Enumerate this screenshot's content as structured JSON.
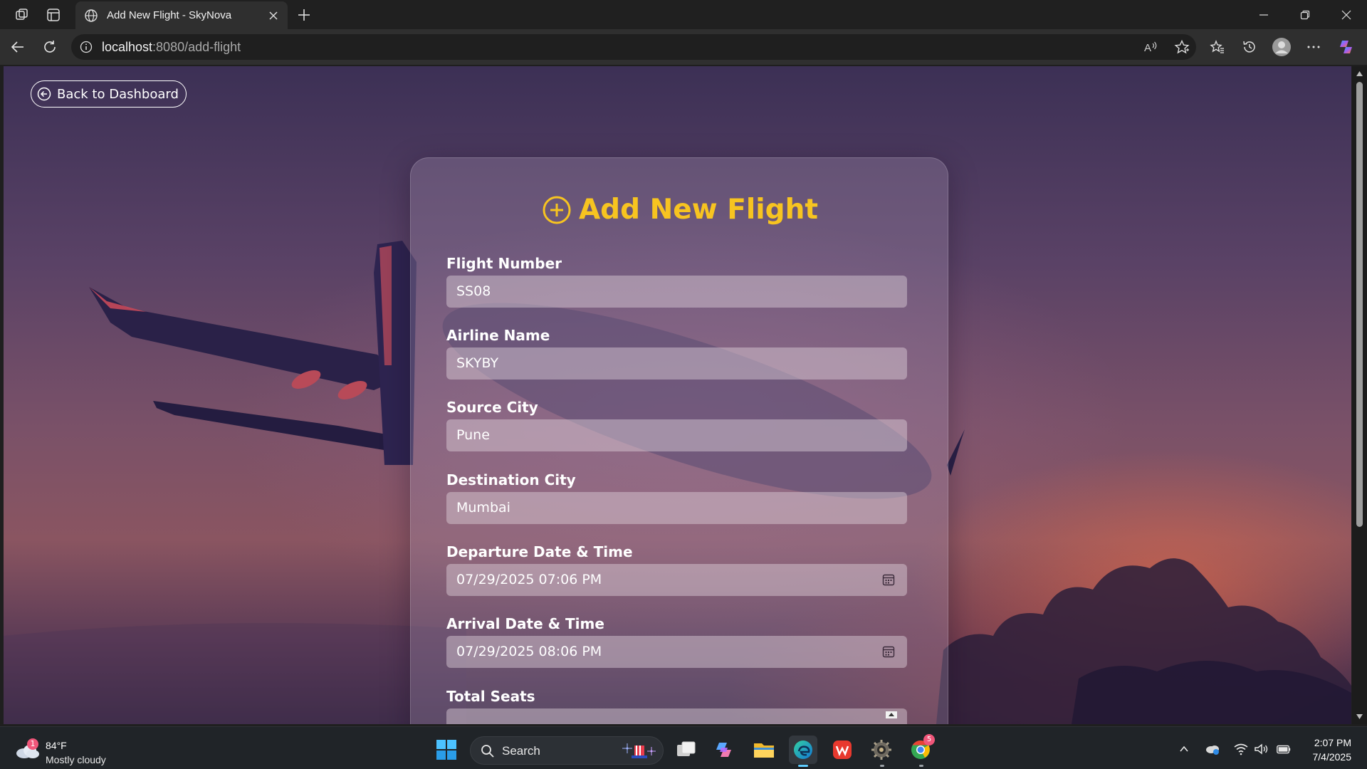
{
  "browser": {
    "tab_title": "Add New Flight - SkyNova",
    "url_host": "localhost",
    "url_path": ":8080/add-flight"
  },
  "page": {
    "back_label": "Back to Dashboard",
    "form_title": "Add New Flight",
    "fields": [
      {
        "label": "Flight Number",
        "value": "SS08"
      },
      {
        "label": "Airline Name",
        "value": "SKYBY"
      },
      {
        "label": "Source City",
        "value": "Pune"
      },
      {
        "label": "Destination City",
        "value": "Mumbai"
      },
      {
        "label": "Departure Date & Time",
        "value": "07/29/2025 07:06 PM"
      },
      {
        "label": "Arrival Date & Time",
        "value": "07/29/2025 08:06 PM"
      },
      {
        "label": "Total Seats",
        "value": ""
      }
    ],
    "colors": {
      "accent": "#f7c420"
    }
  },
  "taskbar": {
    "weather_temp": "84°F",
    "weather_desc": "Mostly cloudy",
    "weather_badge": "1",
    "search_label": "Search",
    "time": "2:07 PM",
    "date": "7/4/2025",
    "chrome_badge": "5"
  }
}
